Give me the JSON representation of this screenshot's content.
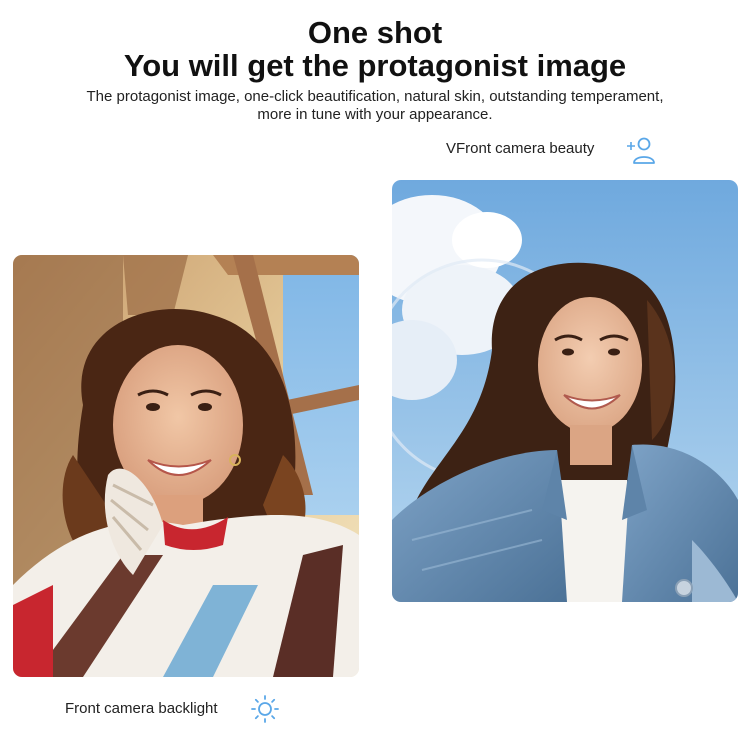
{
  "header": {
    "title_line1": "One shot",
    "title_line2": "You will get the protagonist image",
    "subtitle_line1": "The protagonist image, one-click beautification, natural skin, outstanding temperament,",
    "subtitle_line2": "more in tune with your appearance."
  },
  "features": {
    "right_label": "VFront camera beauty",
    "right_icon": "user-sparkle-icon",
    "left_label": "Front camera backlight",
    "left_icon": "sun-icon"
  },
  "colors": {
    "icon_accent": "#5aa7e8",
    "text": "#222222"
  }
}
